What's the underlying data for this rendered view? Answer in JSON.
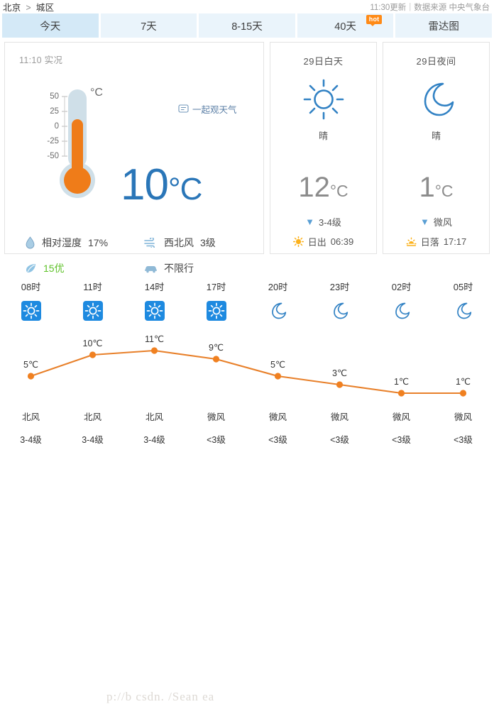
{
  "header": {
    "city": "北京",
    "separator": ">",
    "district": "城区",
    "update_time": "11:30更新",
    "divider": "|",
    "source": "数据来源 中央气象台"
  },
  "tabs": [
    {
      "label": "今天",
      "active": true,
      "badge": null
    },
    {
      "label": "7天",
      "active": false,
      "badge": null
    },
    {
      "label": "8-15天",
      "active": false,
      "badge": null
    },
    {
      "label": "40天",
      "active": false,
      "badge": "hot"
    },
    {
      "label": "雷达图",
      "active": false,
      "badge": null
    }
  ],
  "now": {
    "observed_label": "11:10 实况",
    "temperature": "10",
    "temp_unit": "°C",
    "watch_link": "一起观天气",
    "thermo_scale": [
      "50",
      "25",
      "0",
      "-25",
      "-50"
    ],
    "thermo_unit": "°C",
    "humidity_label": "相对湿度",
    "humidity_value": "17%",
    "wind_label": "西北风",
    "wind_value": "3级",
    "aqi_value": "15优",
    "restriction": "不限行",
    "aqi_color": "#5fc22a",
    "temp_color": "#2a76b8"
  },
  "forecast": [
    {
      "title": "29日白天",
      "icon": "sun-icon",
      "desc": "晴",
      "temp": "12",
      "unit": "°C",
      "wind": "3-4级",
      "sun_label": "日出",
      "sun_time": "06:39",
      "sun_icon": "sunrise-icon"
    },
    {
      "title": "29日夜间",
      "icon": "moon-icon",
      "desc": "晴",
      "temp": "1",
      "unit": "°C",
      "wind": "微风",
      "sun_label": "日落",
      "sun_time": "17:17",
      "sun_icon": "sunset-icon"
    }
  ],
  "hourly": {
    "times": [
      "08时",
      "11时",
      "14时",
      "17时",
      "20时",
      "23时",
      "02时",
      "05时"
    ],
    "icons": [
      "sun-box-icon",
      "sun-box-icon",
      "sun-box-icon",
      "sun-box-icon",
      "moon-icon",
      "moon-icon",
      "moon-icon",
      "moon-icon"
    ],
    "temps": [
      "5℃",
      "10℃",
      "11℃",
      "9℃",
      "5℃",
      "3℃",
      "1℃",
      "1℃"
    ],
    "wind_dir": [
      "北风",
      "北风",
      "北风",
      "微风",
      "微风",
      "微风",
      "微风",
      "微风"
    ],
    "wind_level": [
      "3-4级",
      "3-4级",
      "3-4级",
      "<3级",
      "<3级",
      "<3级",
      "<3级",
      "<3级"
    ]
  },
  "chart_data": {
    "type": "line",
    "title": "",
    "xlabel": "",
    "ylabel": "",
    "categories": [
      "08时",
      "11时",
      "14时",
      "17时",
      "20时",
      "23时",
      "02时",
      "05时"
    ],
    "values": [
      5,
      10,
      11,
      9,
      5,
      3,
      1,
      1
    ],
    "labels": [
      "5℃",
      "10℃",
      "11℃",
      "9℃",
      "5℃",
      "3℃",
      "1℃",
      "1℃"
    ],
    "ylim": [
      0,
      12
    ],
    "grid": false,
    "legend": null,
    "line_color": "#e8802a",
    "point_color": "#f08020"
  },
  "watermark": "p://b    csdn.      /Sean     ea"
}
